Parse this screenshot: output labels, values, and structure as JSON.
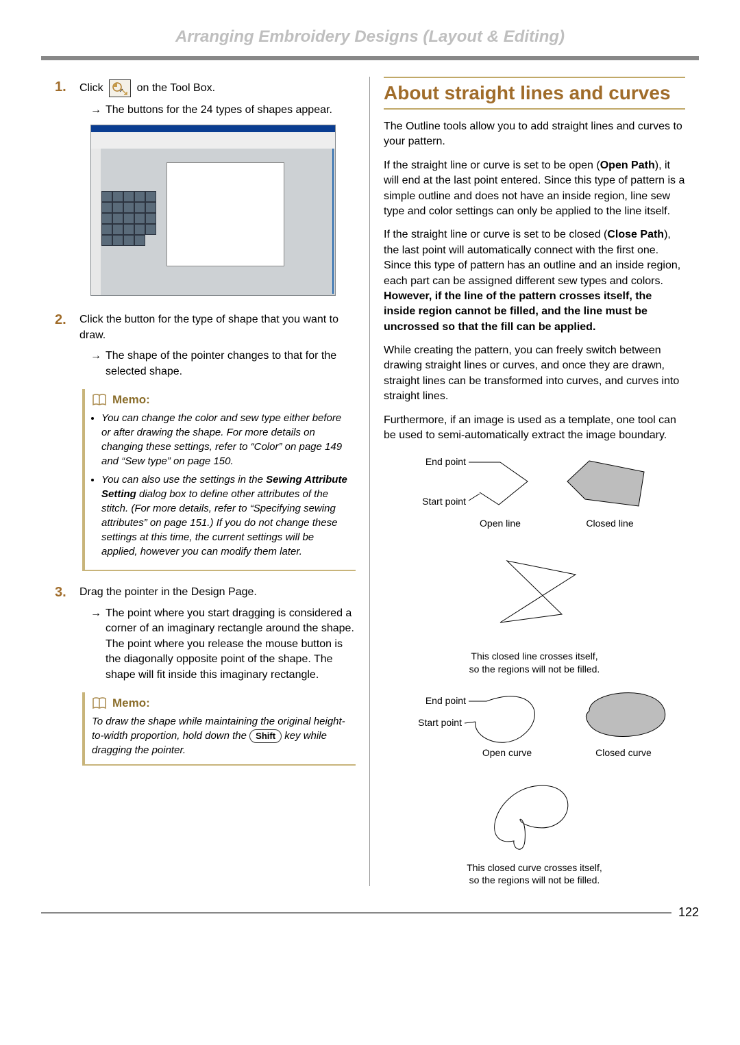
{
  "header": {
    "title": "Arranging Embroidery Designs (Layout & Editing)"
  },
  "left": {
    "step1": {
      "num": "1.",
      "text_before": "Click",
      "text_after": "on the Tool Box.",
      "result": "The buttons for the 24 types of shapes appear."
    },
    "step2": {
      "num": "2.",
      "text": "Click the button for the type of shape that you want to draw.",
      "result": "The shape of the pointer changes to that for the selected shape."
    },
    "memo1": {
      "label": "Memo:",
      "bullet1_a": "You can change the color and sew type either before or after drawing the shape. For more details on changing these settings, refer to “Color” on page 149 and “Sew type” on page 150.",
      "bullet2_a": "You can also use the settings in the ",
      "bullet2_b": "Sewing Attribute Setting",
      "bullet2_c": " dialog box to define other attributes of the stitch. (For more details, refer to “Specifying sewing attributes” on page 151.) If you do not change these settings at this time, the current settings will be applied, however you can modify them later."
    },
    "step3": {
      "num": "3.",
      "text": "Drag the pointer in the Design Page.",
      "result": "The point where you start dragging is considered a corner of an imaginary rectangle around the shape. The point where you release the mouse button is the diagonally opposite point of the shape. The shape will fit inside this imaginary rectangle."
    },
    "memo2": {
      "label": "Memo:",
      "text_a": "To draw the shape while maintaining the original height-to-width proportion, hold down the ",
      "key": "Shift",
      "text_b": " key while dragging the pointer."
    }
  },
  "right": {
    "heading": "About straight lines and curves",
    "p1": "The Outline tools allow you to add straight lines and curves to your pattern.",
    "p2_a": "If the straight line or curve is set to be open (",
    "p2_b": "Open Path",
    "p2_c": "), it will end at the last point entered. Since this type of pattern is a simple outline and does not have an inside region, line sew type and color settings can only be applied to the line itself.",
    "p3_a": "If the straight line or curve is set to be closed (",
    "p3_b": "Close Path",
    "p3_c": "), the last point will automatically connect with the first one. Since this type of pattern has an outline and an inside region, each part can be assigned different sew types and colors. ",
    "p3_d": "However, if the line of the pattern crosses itself, the inside region cannot be filled, and the line must be uncrossed so that the fill can be applied.",
    "p4": "While creating the pattern, you can freely switch between drawing straight lines or curves, and once they are drawn, straight lines can be transformed into curves, and curves into straight lines.",
    "p5": "Furthermore, if an image is used as a template, one tool can be used to semi-automatically extract the image boundary.",
    "labels": {
      "end_point": "End point",
      "start_point": "Start point",
      "open_line": "Open line",
      "closed_line": "Closed line",
      "open_curve": "Open curve",
      "closed_curve": "Closed curve",
      "caption_line": "This closed line crosses itself,\nso the regions will not be filled.",
      "caption_curve": "This closed curve crosses itself,\nso the regions will not be filled."
    }
  },
  "page_number": "122"
}
